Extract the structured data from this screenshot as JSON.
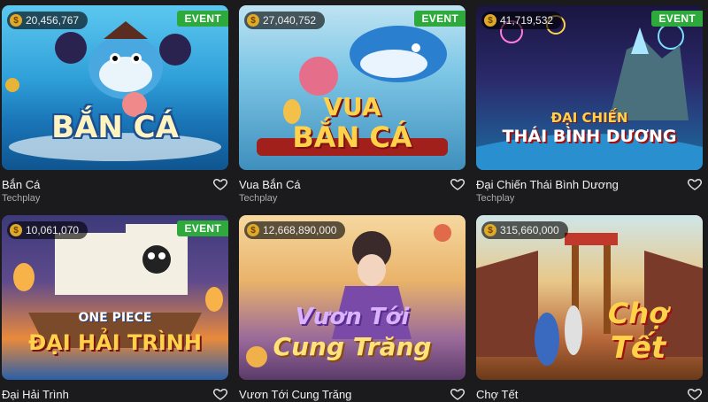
{
  "games": [
    {
      "name": "Bắn Cá",
      "provider": "Techplay",
      "jackpot": "20,456,767",
      "event": "EVENT",
      "logo": "BẮN CÁ"
    },
    {
      "name": "Vua Bắn Cá",
      "provider": "Techplay",
      "jackpot": "27,040,752",
      "event": "EVENT",
      "logo_line1": "VUA",
      "logo_line2": "BẮN CÁ"
    },
    {
      "name": "Đại Chiến Thái Bình Dương",
      "provider": "Techplay",
      "jackpot": "41,719,532",
      "event": "EVENT",
      "logo_line1": "ĐẠI CHIẾN",
      "logo_line2": "THÁI BÌNH DƯƠNG"
    },
    {
      "name": "Đại Hải Trình",
      "provider": "",
      "jackpot": "10,061,070",
      "event": "EVENT",
      "logo_line1": "ONE PIECE",
      "logo_line2": "ĐẠI HẢI TRÌNH"
    },
    {
      "name": "Vươn Tới Cung Trăng",
      "provider": "",
      "jackpot": "12,668,890,000",
      "logo_line1": "Vươn Tới",
      "logo_line2": "Cung Trăng"
    },
    {
      "name": "Chợ Tết",
      "provider": "",
      "jackpot": "315,660,000",
      "logo_line1": "Chợ",
      "logo_line2": "Tết"
    }
  ],
  "coin_symbol": "$"
}
